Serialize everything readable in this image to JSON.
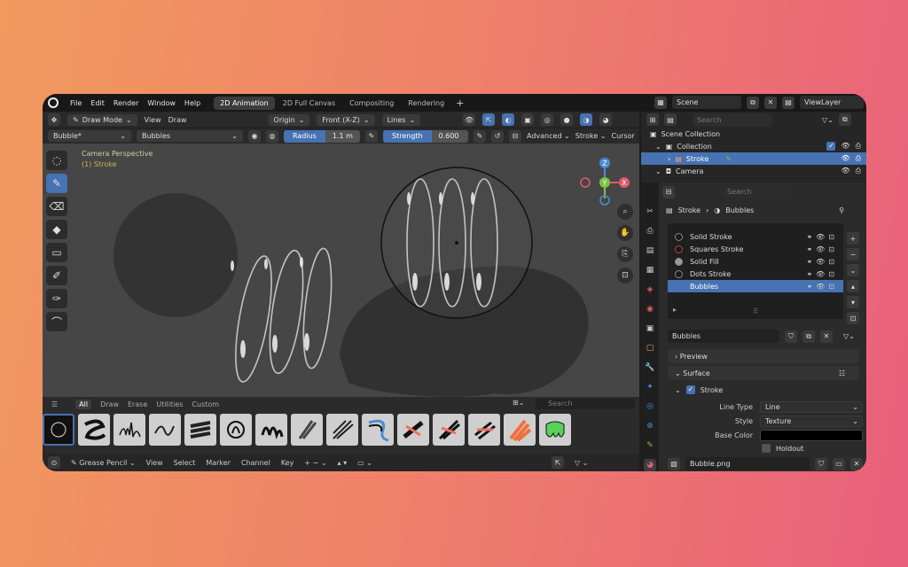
{
  "menu": {
    "items": [
      "File",
      "Edit",
      "Render",
      "Window",
      "Help"
    ],
    "workspaces": [
      "2D Animation",
      "2D Full Canvas",
      "Compositing",
      "Rendering"
    ],
    "active_workspace": "2D Animation",
    "add_workspace": "+"
  },
  "scene": {
    "name": "Scene",
    "view_layer": "ViewLayer"
  },
  "viewport_header": {
    "mode": "Draw Mode",
    "view": "View",
    "draw": "Draw",
    "origin": "Origin",
    "view_axis": "Front (X-Z)",
    "lines": "Lines"
  },
  "tool_settings": {
    "brush": "Bubble*",
    "material": "Bubbles",
    "radius_label": "Radius",
    "radius_value": "1.1 m",
    "strength_label": "Strength",
    "strength_value": "0.600",
    "advanced": "Advanced",
    "stroke": "Stroke",
    "cursor": "Cursor"
  },
  "viewport_info": {
    "line1": "Camera Perspective",
    "line2": "(1) Stroke"
  },
  "gizmo": {
    "z": "Z",
    "y": "Y",
    "x": "X"
  },
  "shelf": {
    "tabs": [
      "All",
      "Draw",
      "Erase",
      "Utilities",
      "Custom"
    ],
    "active_tab": "All",
    "search_placeholder": "Search"
  },
  "timeline": {
    "mode": "Grease Pencil",
    "items": [
      "View",
      "Select",
      "Marker",
      "Channel",
      "Key"
    ]
  },
  "outliner": {
    "search_placeholder": "Search",
    "rows": [
      {
        "label": "Scene Collection",
        "indent": 0
      },
      {
        "label": "Collection",
        "indent": 1
      },
      {
        "label": "Stroke",
        "indent": 2,
        "selected": true
      },
      {
        "label": "Camera",
        "indent": 1
      }
    ]
  },
  "properties": {
    "search_placeholder": "Search",
    "breadcrumb_object": "Stroke",
    "breadcrumb_material": "Bubbles",
    "materials": [
      {
        "name": "Solid Stroke",
        "color": "#1a1a1a"
      },
      {
        "name": "Squares Stroke",
        "color": "#1a1a1a"
      },
      {
        "name": "Solid Fill",
        "color": "#9a9a9a"
      },
      {
        "name": "Dots Stroke",
        "color": "#1a1a1a"
      },
      {
        "name": "Bubbles",
        "color": "#4772b3"
      }
    ],
    "material_name": "Bubbles",
    "preview": "Preview",
    "surface": "Surface",
    "stroke": "Stroke",
    "line_type_label": "Line Type",
    "line_type_value": "Line",
    "style_label": "Style",
    "style_value": "Texture",
    "base_color_label": "Base Color",
    "base_color": "#000000",
    "holdout": "Holdout",
    "image": "Bubble.png"
  },
  "colors": {
    "accent": "#4772b3",
    "x_axis": "#e05a6a",
    "y_axis": "#7ac343",
    "z_axis": "#4a8cd8"
  }
}
